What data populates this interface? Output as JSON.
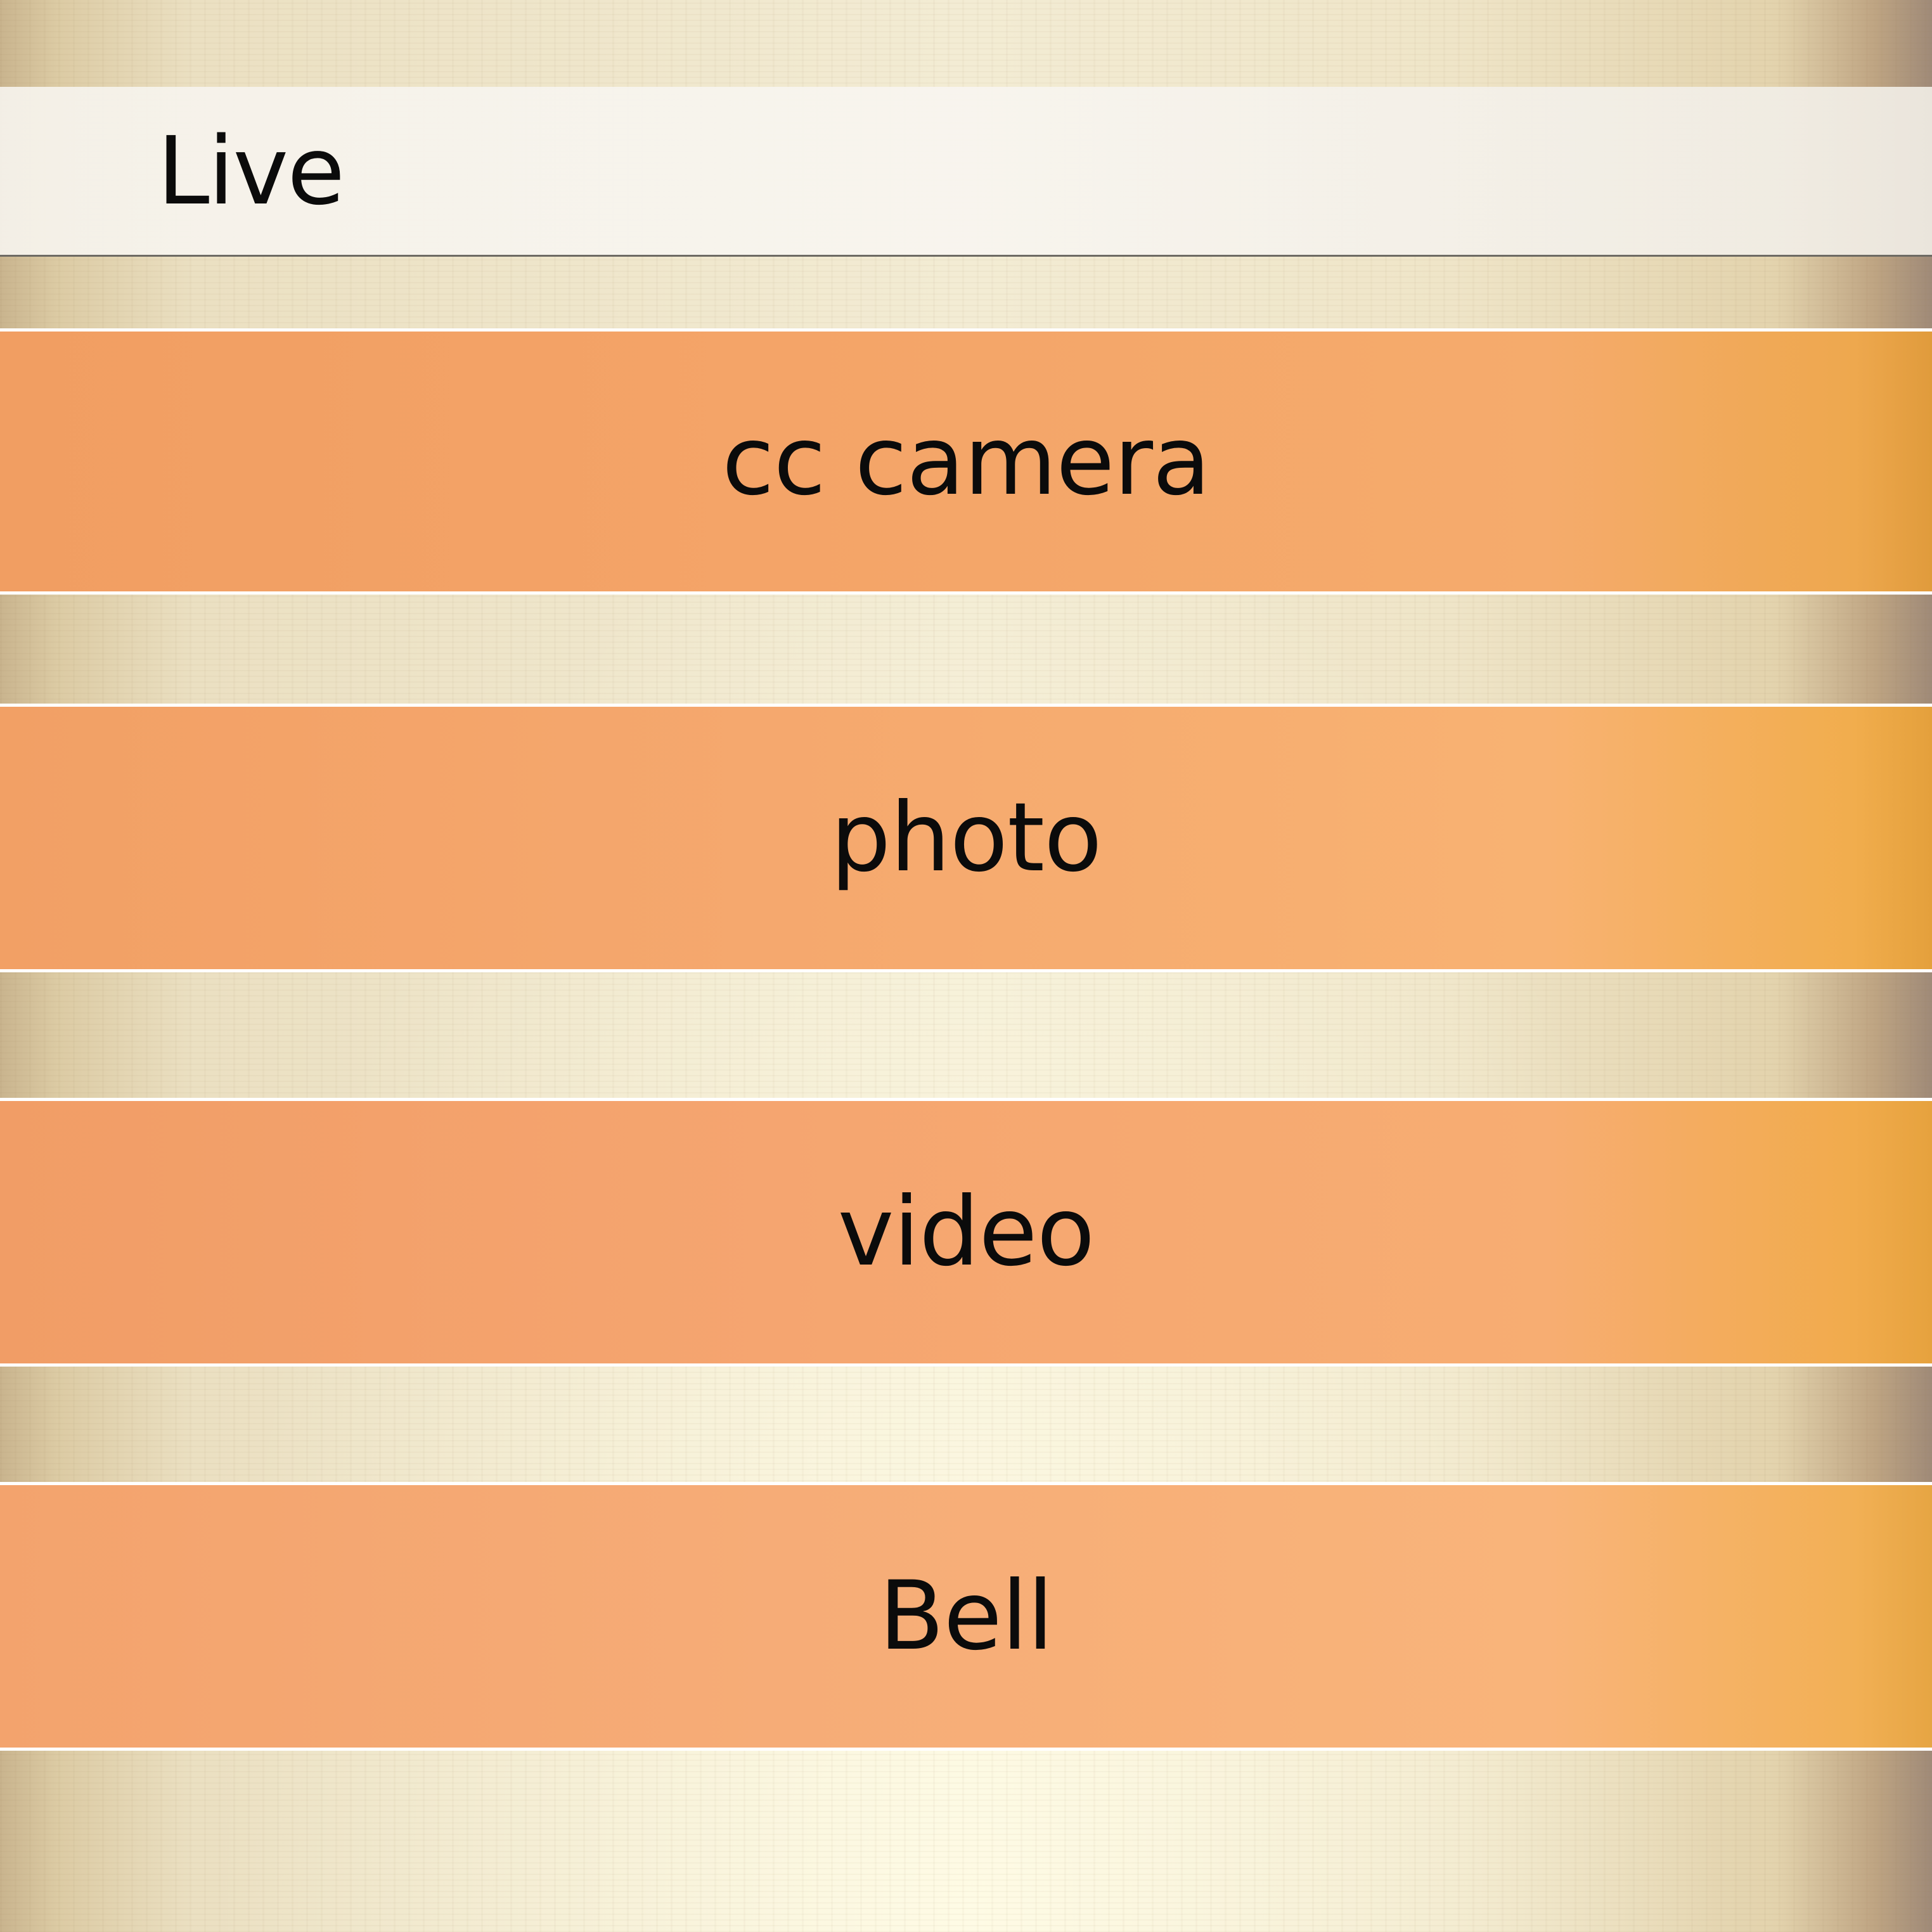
{
  "header": {
    "title": "Live"
  },
  "menu": {
    "items": [
      {
        "label": "cc camera"
      },
      {
        "label": "photo"
      },
      {
        "label": "video"
      },
      {
        "label": "Bell"
      }
    ]
  },
  "colors": {
    "header_background": "#f6f3ec",
    "menu_item_background": "#f5a86c",
    "menu_item_accent_edge": "#eea84e",
    "divider": "#ffffff",
    "text": "#0b0b0b",
    "background_paper": "#efe6cb"
  }
}
